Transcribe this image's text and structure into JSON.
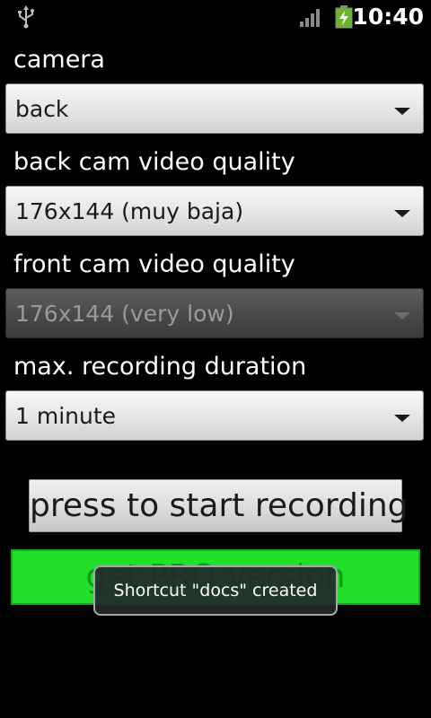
{
  "status_bar": {
    "usb_icon": "usb-icon",
    "signal_icon": "signal-icon",
    "battery_icon": "battery-charging-icon",
    "time": "10:40"
  },
  "camera": {
    "label": "camera",
    "value": "back"
  },
  "back_quality": {
    "label": "back cam video quality",
    "value": "176x144 (muy baja)"
  },
  "front_quality": {
    "label": "front cam video quality",
    "value": "176x144 (very low)"
  },
  "duration": {
    "label": "max. recording duration",
    "value": "1 minute"
  },
  "record_button": {
    "label": "press to start recording"
  },
  "pro_button": {
    "label": "get PRO version",
    "color": "#22e02a"
  },
  "toast": {
    "message": "Shortcut \"docs\" created"
  }
}
